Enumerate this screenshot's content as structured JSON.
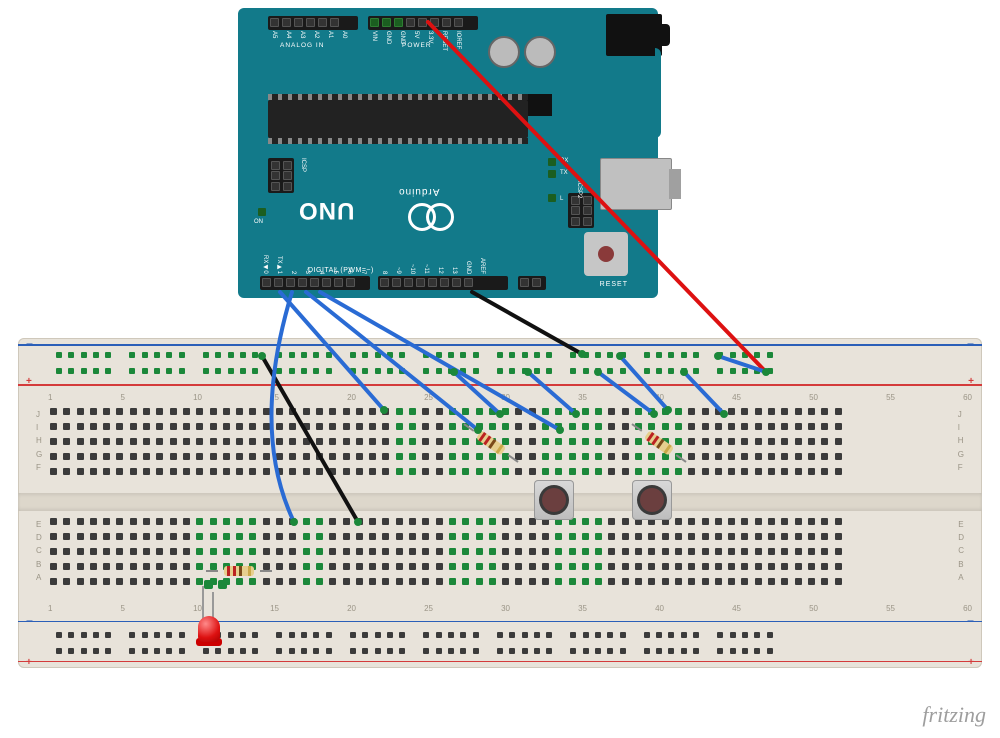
{
  "watermark": "fritzing",
  "arduino": {
    "board_name": "UNO",
    "brand": "Arduino",
    "digital_label": "DIGITAL (PWM=~)",
    "analog_label": "ANALOG IN",
    "power_label": "POWER",
    "icsp_label": "ICSP",
    "icsp2_label": "ICSP2",
    "reset_label": "RESET",
    "on_label": "ON",
    "leds": {
      "tx": "TX",
      "rx": "RX",
      "l": "L"
    },
    "pins_analog": [
      "A0",
      "A1",
      "A2",
      "A3",
      "A4",
      "A5"
    ],
    "pins_power": [
      "IOREF",
      "RESET",
      "3.3V",
      "5V",
      "GND",
      "GND",
      "VIN"
    ],
    "pins_digital_a": [
      "RX◀0",
      "TX▶1",
      "2",
      "~3",
      "4",
      "~5",
      "~6",
      "7"
    ],
    "pins_digital_b": [
      "8",
      "~9",
      "~10",
      "~11",
      "12",
      "13",
      "GND",
      "AREF"
    ],
    "pins_right_spare": [
      "",
      ""
    ]
  },
  "breadboard": {
    "columns": 60,
    "row_letters_top": [
      "J",
      "I",
      "H",
      "G",
      "F"
    ],
    "row_letters_bottom": [
      "E",
      "D",
      "C",
      "B",
      "A"
    ],
    "numbers": [
      "1",
      "5",
      "10",
      "15",
      "20",
      "25",
      "30",
      "35",
      "40",
      "45",
      "50",
      "55",
      "60"
    ],
    "rail_symbols": {
      "plus": "+",
      "minus": "−"
    }
  },
  "components": {
    "led": {
      "color": "red",
      "position": "lower-left"
    },
    "resistors": [
      {
        "value_colors": "red-red-brown-gold",
        "location": "LED cathode to row"
      },
      {
        "value_colors": "red-red-brown-gold",
        "location": "button1 pulldown (diagonal)"
      },
      {
        "value_colors": "red-red-brown-gold",
        "location": "button2 pulldown (diagonal)"
      }
    ],
    "pushbuttons": 2,
    "wires": [
      {
        "color": "red",
        "from": "Arduino 5V",
        "to": "breadboard + rail (right)"
      },
      {
        "color": "black",
        "from": "Arduino GND(dig)",
        "to": "breadboard − rail"
      },
      {
        "color": "black",
        "from": "breadboard − rail",
        "to": "row E (LED gnd via resistor)"
      },
      {
        "color": "blue",
        "from": "Arduino D2",
        "to": "LED anode row"
      },
      {
        "color": "blue",
        "from": "Arduino D3",
        "to": "button1 signal row"
      },
      {
        "color": "blue",
        "from": "Arduino D4",
        "to": "button2 signal row"
      },
      {
        "color": "blue",
        "from": "+ rail",
        "to": "button1 supply"
      },
      {
        "color": "blue",
        "from": "+ rail",
        "to": "button2 supply"
      },
      {
        "color": "blue",
        "from": "+ rail",
        "to": "+ rail bridge A"
      },
      {
        "color": "blue",
        "from": "+ rail",
        "to": "+ rail bridge B"
      },
      {
        "color": "blue",
        "from": "button1 gnd",
        "to": "− rail"
      },
      {
        "color": "blue",
        "from": "button2 gnd",
        "to": "− rail"
      }
    ]
  }
}
